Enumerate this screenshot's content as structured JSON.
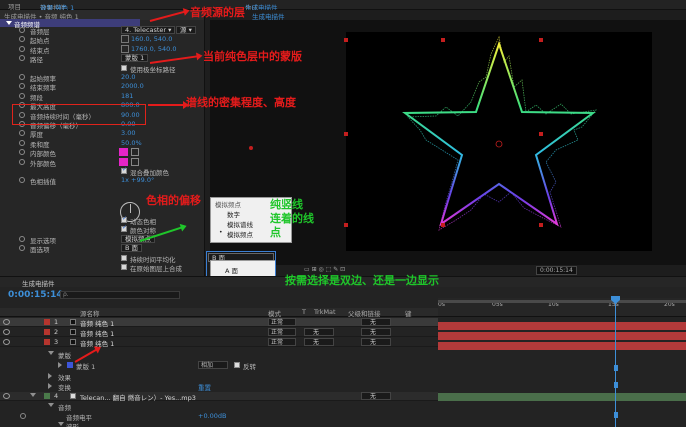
{
  "top_bar": {
    "left_label": "项目",
    "effect_tab_prefix": "效果控件",
    "effect_tab_accent": "音频 纯色 1",
    "comp_tab_prefix": "合成",
    "comp_tab_accent": "生成电描件"
  },
  "effect_panel": {
    "header": "生成电描件 • 音频 纯色 1",
    "group": "音频频谱",
    "rows": [
      {
        "name": "音频层",
        "kind": "dropdown",
        "value": "4. Telecaster ▾",
        "extra": "源 ▾"
      },
      {
        "name": "起始点",
        "kind": "point",
        "value": "160.0, 540.0"
      },
      {
        "name": "结束点",
        "kind": "point",
        "value": "1760.0, 540.0"
      },
      {
        "name": "路径",
        "kind": "dropdown",
        "value": "蒙版 1"
      },
      {
        "name": "",
        "kind": "checkbox",
        "value": "使用极坐标路径",
        "checked": false
      },
      {
        "name": "起始频率",
        "kind": "value",
        "value": "20.0"
      },
      {
        "name": "结束频率",
        "kind": "value",
        "value": "2000.0"
      },
      {
        "name": "频段",
        "kind": "value",
        "value": "181"
      },
      {
        "name": "最大高度",
        "kind": "value",
        "value": "800.0"
      },
      {
        "name": "音频持续时间（毫秒）",
        "kind": "value",
        "value": "90.00"
      },
      {
        "name": "音频偏移（毫秒）",
        "kind": "value",
        "value": "0.00"
      },
      {
        "name": "厚度",
        "kind": "value",
        "value": "3.00"
      },
      {
        "name": "柔和度",
        "kind": "value",
        "value": "50.0%"
      },
      {
        "name": "内部颜色",
        "kind": "color",
        "value": ""
      },
      {
        "name": "外部颜色",
        "kind": "color",
        "value": ""
      },
      {
        "name": "",
        "kind": "checkbox",
        "value": "混合叠加颜色",
        "checked": true
      },
      {
        "name": "色相插值",
        "kind": "value",
        "value": "1x +99.0°"
      }
    ],
    "rows_lower": [
      {
        "name": "",
        "kind": "checkbox",
        "value": "动态色相",
        "checked": true
      },
      {
        "name": "",
        "kind": "checkbox",
        "value": "颜色对称",
        "checked": true
      },
      {
        "name": "显示选项",
        "kind": "dropdown",
        "value": "模拟频点"
      },
      {
        "name": "面选项",
        "kind": "dropdown",
        "value": "B 面"
      },
      {
        "name": "",
        "kind": "checkbox",
        "value": "持续时间平均化",
        "checked": false
      },
      {
        "name": "",
        "kind": "checkbox",
        "value": "在原始图层上合成",
        "checked": false
      }
    ]
  },
  "popup_connect": {
    "title": "模拟频点",
    "options": [
      "数字",
      "模拟谱线",
      "模拟频点"
    ],
    "selected_index": 2
  },
  "popup_side": {
    "title": "B 面",
    "options": [
      "A 面",
      "B 面",
      "A 和 B 面"
    ],
    "selected_index": 1
  },
  "comp_viewer": {
    "tab_label": "生成电描件",
    "toolbar_time": "0:00:15:14"
  },
  "timeline": {
    "tab": "生成电描件",
    "current_time": "0:00:15:14",
    "search_icon_label": "ρ.",
    "column_headers": {
      "source": "源名称",
      "mode": "模式",
      "trkmat": "TrkMat",
      "parent": "父级和链接",
      "mode_hdr": "T",
      "keys": "键"
    },
    "ruler_marks": [
      "0s",
      "05s",
      "10s",
      "15s",
      "20s"
    ],
    "layers": [
      {
        "num": "1",
        "name": "音频 纯色 1",
        "mode": "正常",
        "trkmat": "",
        "parent": "无"
      },
      {
        "num": "2",
        "name": "音频 纯色 1",
        "mode": "正常",
        "trkmat": "无",
        "parent": "无"
      },
      {
        "num": "3",
        "name": "音频 纯色 1",
        "mode": "正常",
        "trkmat": "无",
        "parent": "无"
      }
    ],
    "sub_rows": {
      "masks": "蒙版",
      "mask1": "蒙版 1",
      "mask1_mode": "相加",
      "mask1_invert": "反转",
      "effects": "效果",
      "transform": "变换",
      "transform_reset": "重置"
    },
    "audio_layer": {
      "num": "4",
      "name": "Telecan... 翻自 燃音レン）- Yes...mp3",
      "parent": "无"
    },
    "audio_sub": {
      "audio": "音频",
      "level_label": "音频电平",
      "level_value": "+0.00dB",
      "waveform": "波形"
    }
  },
  "annotations": {
    "audio_layer": "音频源的层",
    "mask": "当前纯色层中的蒙版",
    "density": "谱线的密集程度、高度",
    "hue": "色相的偏移",
    "connect": "纯竖线\n连着的线\n点",
    "side": "按需选择是双边、还是一边显示"
  },
  "colors": {
    "accent_blue": "#3d8fd8",
    "annotation_red": "#e41b1b",
    "annotation_green": "#1fc62a",
    "layer_label_red": "#b5352e",
    "swatch_magenta": "#e524c8"
  }
}
